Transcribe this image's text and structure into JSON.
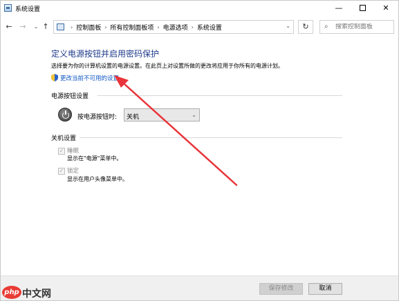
{
  "window": {
    "title": "系统设置",
    "minimize_glyph": "—",
    "close_glyph": "✕"
  },
  "nav": {
    "back_glyph": "←",
    "forward_glyph": "→",
    "recent_glyph": "⌄",
    "up_glyph": "↑",
    "breadcrumbs": [
      "控制面板",
      "所有控制面板项",
      "电源选项",
      "系统设置"
    ],
    "refresh_glyph": "↻",
    "search_placeholder": "搜索控制面板"
  },
  "content": {
    "heading": "定义电源按钮并启用密码保护",
    "description": "选择要为你的计算机设置的电源设置。在此页上对设置所做的更改将应用于你所有的电源计划。",
    "change_link": "更改当前不可用的设置",
    "power_section": {
      "title": "电源按钮设置",
      "label": "按电源按钮时:",
      "selected_value": "关机"
    },
    "shutdown_section": {
      "title": "关机设置",
      "items": [
        {
          "label": "睡眠",
          "sub": "显示在\"电源\"菜单中。",
          "checked": true
        },
        {
          "label": "锁定",
          "sub": "显示在用户头像菜单中。",
          "checked": true
        }
      ]
    }
  },
  "footer": {
    "save_label": "保存修改",
    "cancel_label": "取消"
  },
  "watermark": {
    "logo_text": "php",
    "site_text": "中文网"
  },
  "colors": {
    "heading": "#1e3a8a",
    "link": "#0b55c4",
    "annotation_arrow": "#e8343a"
  }
}
